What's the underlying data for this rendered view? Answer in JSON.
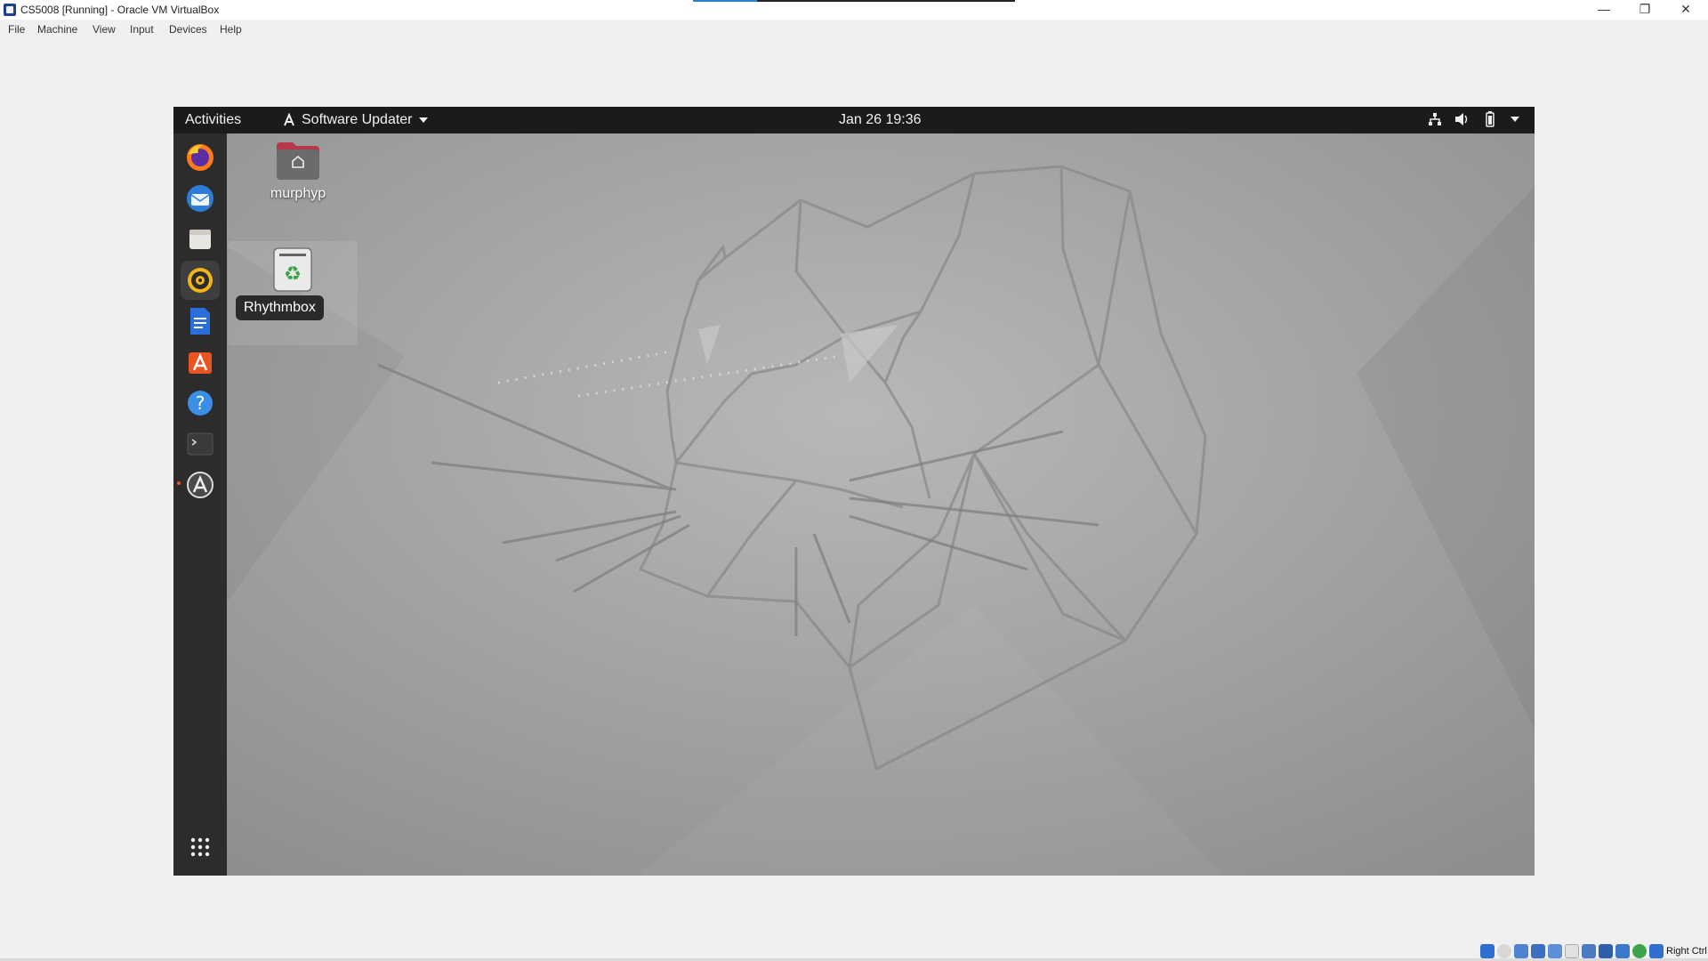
{
  "window": {
    "title": "CS5008 [Running] - Oracle VM VirtualBox",
    "controls": {
      "minimize": "—",
      "maximize": "❐",
      "close": "✕"
    }
  },
  "menu": [
    "File",
    "Machine",
    "View",
    "Input",
    "Devices",
    "Help"
  ],
  "guest": {
    "topbar": {
      "activities": "Activities",
      "app_menu": "Software Updater",
      "clock": "Jan 26  19:36"
    },
    "dock": [
      {
        "name": "Firefox",
        "icon": "firefox-icon"
      },
      {
        "name": "Thunderbird",
        "icon": "thunderbird-icon"
      },
      {
        "name": "Files",
        "icon": "files-icon"
      },
      {
        "name": "Rhythmbox",
        "icon": "rhythmbox-icon"
      },
      {
        "name": "LibreOffice Writer",
        "icon": "writer-icon"
      },
      {
        "name": "Ubuntu Software",
        "icon": "ubuntu-software-icon"
      },
      {
        "name": "Help",
        "icon": "help-icon"
      },
      {
        "name": "Terminal",
        "icon": "terminal-icon"
      },
      {
        "name": "Software Updater",
        "icon": "software-updater-icon"
      },
      {
        "name": "Show Applications",
        "icon": "app-grid-icon"
      }
    ],
    "desktop": {
      "home_folder": "murphyp",
      "tooltip": "Rhythmbox"
    }
  },
  "status": {
    "host_key": "Right Ctrl"
  },
  "colors": {
    "ubuntu_orange": "#e95420",
    "topbar": "#1b1b1b",
    "dock": "#2c2c2c"
  }
}
